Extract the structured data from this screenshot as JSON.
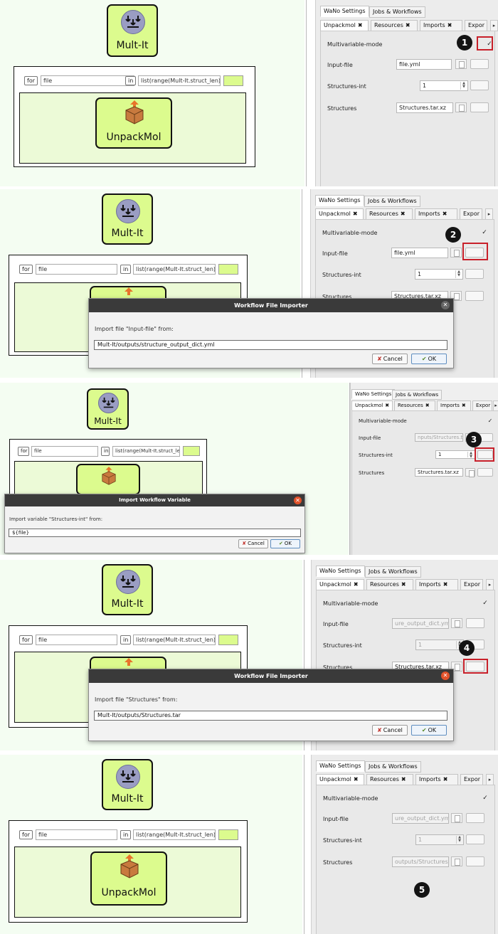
{
  "node": {
    "mult": "Mult-It",
    "unpack": "UnpackMol"
  },
  "loop": {
    "for": "for",
    "var": "file",
    "in": "in",
    "expr": "list(range(Mult-It.struct_len))"
  },
  "tabs": {
    "wano": "WaNo Settings",
    "jobs": "Jobs & Workflows",
    "unpack": "Unpackmol",
    "unpack_alt": "Unpackmol",
    "resources": "Resources",
    "imports": "Imports",
    "export": "Expor"
  },
  "fields": {
    "multivariable": "Multivariable-mode",
    "input_file": "Input-file",
    "structures_int": "Structures-int",
    "structures": "Structures"
  },
  "panel1": {
    "input_file": "file.yml",
    "structures_int": "1",
    "structures": "Structures.tar.xz",
    "badge": "1"
  },
  "panel2": {
    "input_file": "file.yml",
    "structures_int": "1",
    "structures": "Structures.tar.xz",
    "badge": "2",
    "dialog": {
      "title": "Workflow File Importer",
      "prompt": "Import file \"Input-file\" from:",
      "value": "Mult-It/outputs/structure_output_dict.yml",
      "cancel": "Cancel",
      "ok": "OK"
    }
  },
  "panel3": {
    "input_file": "nputs/Structures.tar",
    "structures_int": "1",
    "structures": "Structures.tar.xz",
    "badge": "3",
    "dialog": {
      "title": "Import Workflow Variable",
      "prompt": "Import variable \"Structures-int\" from:",
      "value": "${file}",
      "cancel": "Cancel",
      "ok": "OK"
    }
  },
  "panel4": {
    "input_file": "ure_output_dict.yml",
    "structures_int": "1",
    "structures": "Structures.tar.xz",
    "badge": "4",
    "dialog": {
      "title": "Workflow File Importer",
      "prompt": "Import file \"Structures\" from:",
      "value": "Mult-It/outputs/Structures.tar",
      "cancel": "Cancel",
      "ok": "OK"
    }
  },
  "panel5": {
    "input_file": "ure_output_dict.yml",
    "structures_int": "1",
    "structures": "outputs/Structures.tar",
    "badge": "5"
  },
  "colors": {
    "node": "#dcfb8e",
    "canvas": "#f4fdf2",
    "highlight": "#c8202a",
    "badge": "#141414"
  }
}
